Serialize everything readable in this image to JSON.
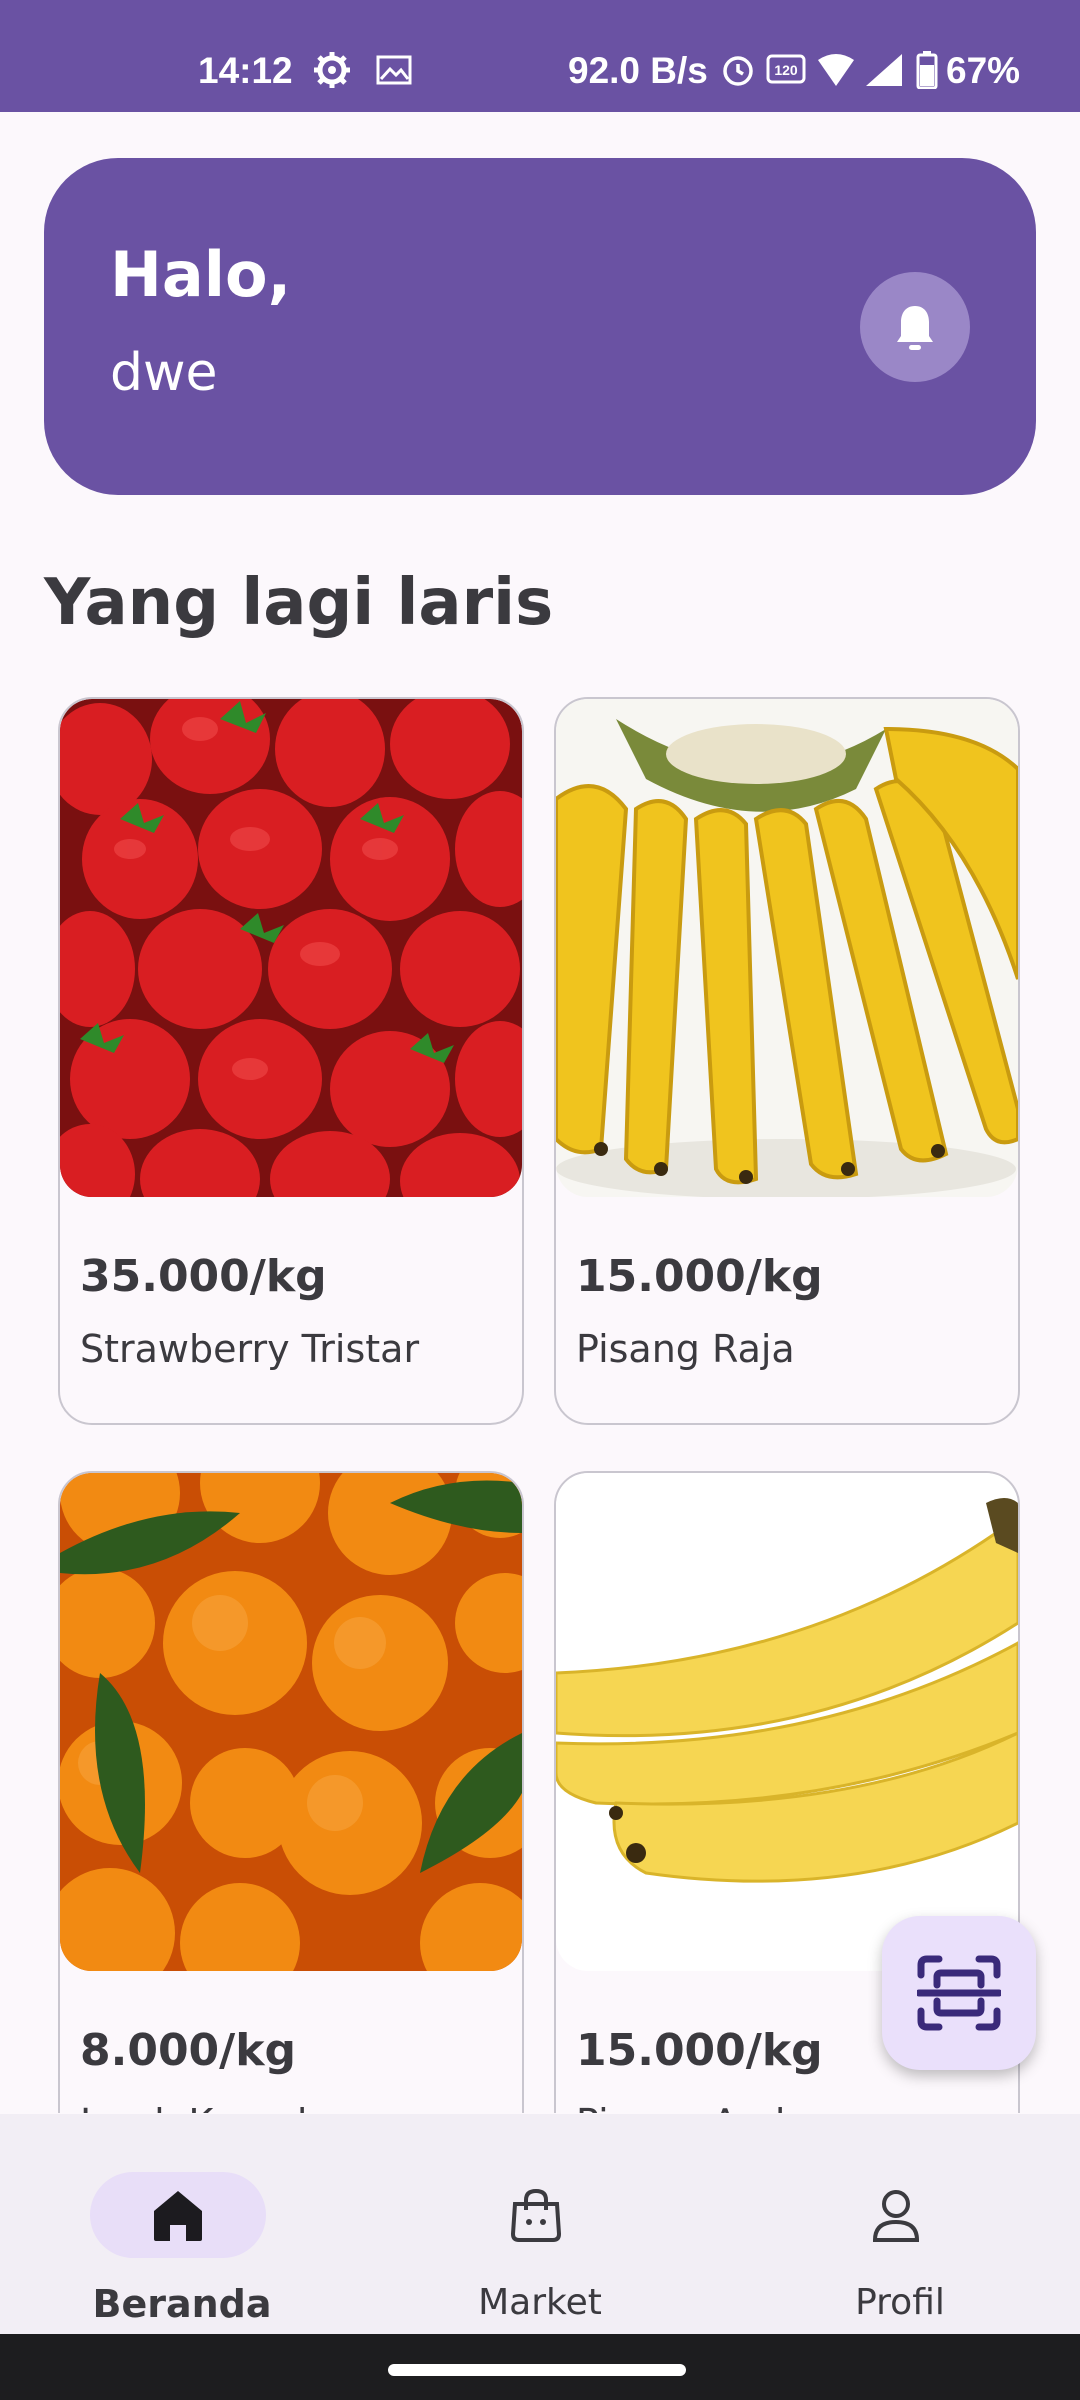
{
  "status_bar": {
    "time": "14:12",
    "network_speed": "92.0 B/s",
    "battery": "67%",
    "icons": [
      "settings-icon",
      "image-icon",
      "alarm-icon",
      "refresh-rate-icon",
      "wifi-icon",
      "signal-icon",
      "battery-icon"
    ]
  },
  "header": {
    "greeting": "Halo,",
    "username": "dwe",
    "notification_icon": "bell-icon"
  },
  "section_title": "Yang lagi laris",
  "products": [
    {
      "price": "35.000/kg",
      "name": "Strawberry Tristar",
      "image": "strawberries"
    },
    {
      "price": "15.000/kg",
      "name": "Pisang Raja",
      "image": "bananas"
    },
    {
      "price": "8.000/kg",
      "name": "Jeruk Keprok",
      "image": "oranges"
    },
    {
      "price": "15.000/kg",
      "name": "Pisang Ambon",
      "image": "bananas"
    }
  ],
  "fab": {
    "icon": "scan-icon"
  },
  "nav": {
    "items": [
      {
        "label": "Beranda",
        "icon": "home-icon",
        "active": true
      },
      {
        "label": "Market",
        "icon": "shopping-bag-icon",
        "active": false
      },
      {
        "label": "Profil",
        "icon": "person-icon",
        "active": false
      }
    ]
  },
  "colors": {
    "primary": "#6a52a3",
    "background": "#fcf8fc",
    "nav_background": "#f2eef5",
    "active_pill": "#e8def8"
  }
}
